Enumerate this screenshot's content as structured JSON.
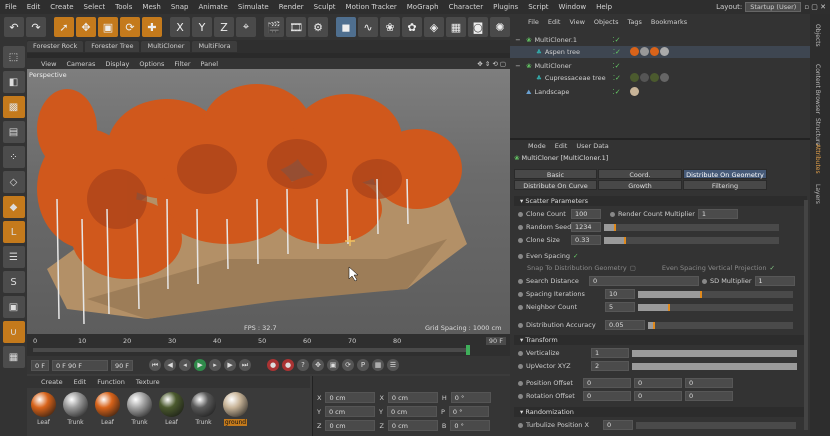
{
  "menu": [
    "File",
    "Edit",
    "Create",
    "Select",
    "Tools",
    "Mesh",
    "Snap",
    "Animate",
    "Simulate",
    "Render",
    "Sculpt",
    "Motion Tracker",
    "MoGraph",
    "Character",
    "Plugins",
    "Script",
    "Window",
    "Help"
  ],
  "layout": {
    "label": "Layout:",
    "value": "Startup (User)"
  },
  "toolbar": {
    "x": "X",
    "y": "Y",
    "z": "Z"
  },
  "view_tabs": [
    "Forester Rock",
    "Forester Tree",
    "MultiCloner",
    "MultiFlora"
  ],
  "view_menu": [
    "View",
    "Cameras",
    "Display",
    "Options",
    "Filter",
    "Panel"
  ],
  "viewport": {
    "label": "Perspective",
    "fps": "FPS : 32.7",
    "grid": "Grid Spacing : 1000 cm"
  },
  "timeline": {
    "ticks": [
      "0",
      "10",
      "20",
      "30",
      "40",
      "50",
      "60",
      "70",
      "80"
    ],
    "end": "90 F",
    "current": "90 F"
  },
  "transport": {
    "start": "0 F",
    "range": "0 F  90 F",
    "end": "90 F"
  },
  "material_menu": [
    "Create",
    "Edit",
    "Function",
    "Texture"
  ],
  "materials": [
    {
      "name": "Leaf",
      "color": "#d8631a"
    },
    {
      "name": "Trunk",
      "color": "#9a9a9a"
    },
    {
      "name": "Leaf",
      "color": "#d8631a"
    },
    {
      "name": "Trunk",
      "color": "#a5a5a5"
    },
    {
      "name": "Leaf",
      "color": "#4b5a2e"
    },
    {
      "name": "Trunk",
      "color": "#5a5a5a"
    },
    {
      "name": "ground",
      "color": "#c8b498"
    }
  ],
  "coords": {
    "x": "X",
    "y": "Y",
    "z": "Z",
    "val": "0 cm",
    "h": "H",
    "p": "P",
    "b": "B",
    "deg": "0 °"
  },
  "object_menu": [
    "File",
    "Edit",
    "View",
    "Objects",
    "Tags",
    "Bookmarks"
  ],
  "objects": [
    "MultiCloner.1",
    "Aspen tree",
    "MultiCloner",
    "Cupressaceae tree",
    "Landscape"
  ],
  "attr_menu": [
    "Mode",
    "Edit",
    "User Data"
  ],
  "attr_title": "MultiCloner [MultiCloner.1]",
  "attr_tabs": [
    "Basic",
    "Coord.",
    "Distribute On Geometry",
    "Distribute On Curve",
    "Growth",
    "Filtering"
  ],
  "sections": {
    "scatter": "Scatter Parameters",
    "transform": "Transform",
    "random": "Randomization"
  },
  "params": {
    "clone_count": {
      "label": "Clone Count",
      "value": "100"
    },
    "render_mult": {
      "label": "Render Count Multiplier",
      "value": "1"
    },
    "seed": {
      "label": "Random Seed",
      "value": "1234"
    },
    "clone_size": {
      "label": "Clone Size",
      "value": "0.33"
    },
    "even": {
      "label": "Even Spacing"
    },
    "snap": {
      "label": "Snap To Distribution Geometry"
    },
    "even_vert": {
      "label": "Even Spacing Vertical Projection"
    },
    "search": {
      "label": "Search Distance",
      "value": "0"
    },
    "sd_mult": {
      "label": "SD Multiplier",
      "value": "1"
    },
    "iter": {
      "label": "Spacing Iterations",
      "value": "10"
    },
    "neighbor": {
      "label": "Neighbor Count",
      "value": "5"
    },
    "accuracy": {
      "label": "Distribution Accuracy",
      "value": "0.05"
    },
    "verticalize": {
      "label": "Verticalize",
      "value": "1"
    },
    "upvector": {
      "label": "UpVector XYZ",
      "value": "2"
    },
    "pos_offset": {
      "label": "Position Offset",
      "value": "0"
    },
    "rot_offset": {
      "label": "Rotation Offset",
      "value": "0"
    },
    "turb_x": {
      "label": "Turbulize Position X",
      "value": "0"
    }
  },
  "right_tabs": [
    "Objects",
    "Content Browser",
    "Structure",
    "Attributes",
    "Layers"
  ]
}
